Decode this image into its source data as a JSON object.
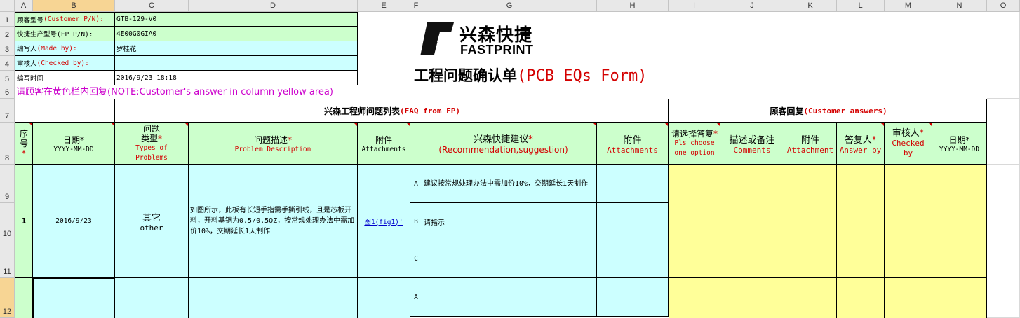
{
  "columns": [
    "A",
    "B",
    "C",
    "D",
    "E",
    "F",
    "G",
    "H",
    "I",
    "J",
    "K",
    "L",
    "M",
    "N",
    "O"
  ],
  "rows": [
    "1",
    "2",
    "3",
    "4",
    "5",
    "6",
    "7",
    "8",
    "9",
    "10",
    "11",
    "12"
  ],
  "info": {
    "customer_pn_label_cn": "顾客型号",
    "customer_pn_label_en": "(Customer P/N):",
    "customer_pn_value": "GTB-129-V0",
    "fp_pn_label": "快捷生产型号(FP P/N):",
    "fp_pn_value": "4E00G0GIA0",
    "made_by_label_cn": "编写人",
    "made_by_label_en": "(Made by):",
    "made_by_value": "罗桂花",
    "checked_by_label_cn": "审核人",
    "checked_by_label_en": "(Checked by):",
    "checked_by_value": "",
    "time_label": "编写时间",
    "time_value": "2016/9/23 18:18"
  },
  "logo": {
    "cn": "兴森快捷",
    "en": "FASTPRINT",
    "glyph": "P"
  },
  "form_title": {
    "cn": "工程问题确认单",
    "en": "(PCB EQs Form)"
  },
  "note": "请顾客在黄色栏内回复(NOTE:Customer's answer in column yellow area)",
  "sections": {
    "fp_cn": "兴森工程师问题列表",
    "fp_en": "(FAQ from FP)",
    "cust_cn": "顾客回复",
    "cust_en": "(Customer answers)"
  },
  "headers": {
    "seq": "序号",
    "seq_star": "*",
    "date": "日期*",
    "date_fmt": "YYYY-MM-DD",
    "type_cn1": "问题",
    "type_cn2": "类型",
    "type_star": "*",
    "type_en1": "Types of",
    "type_en2": "Problems",
    "desc_cn": "问题描述",
    "desc_star": "*",
    "desc_en": "Problem Description",
    "att_cn": "附件",
    "att_en": "Attachments",
    "rec_cn": "兴森快捷建议",
    "rec_star": "*",
    "rec_en": "(Recommendation,suggestion)",
    "att2_cn": "附件",
    "att2_en": "Attachments",
    "choose_cn": "请选择答复",
    "choose_star": "*",
    "choose_en1": "Pls choose",
    "choose_en2": "one option",
    "comments_cn": "描述或备注",
    "comments_en": "Comments",
    "attach_cn": "附件",
    "attach_en": "Attachment",
    "answer_cn": "答复人",
    "answer_star": "*",
    "answer_en": "Answer by",
    "checker_cn": "审核人",
    "checker_star": "*",
    "checker_en1": "Checked",
    "checker_en2": "by",
    "cdate_cn": "日期*",
    "cdate_fmt": "YYYY-MM-DD"
  },
  "item1": {
    "seq": "1",
    "date": "2016/9/23",
    "type_cn": "其它",
    "type_en": "other",
    "desc": "如图所示，此板有长短手指需手撕引线，且是芯板开料，开料基铜为0.5/0.5OZ，按常规处理办法中需加价10%，交期延长1天制作",
    "attachment": "图1(fig1)'",
    "options": [
      {
        "key": "A",
        "text": "建议按常规处理办法中需加价10%，交期延长1天制作"
      },
      {
        "key": "B",
        "text": "请指示"
      },
      {
        "key": "C",
        "text": ""
      }
    ]
  },
  "item2": {
    "options": [
      {
        "key": "A",
        "text": ""
      }
    ]
  }
}
